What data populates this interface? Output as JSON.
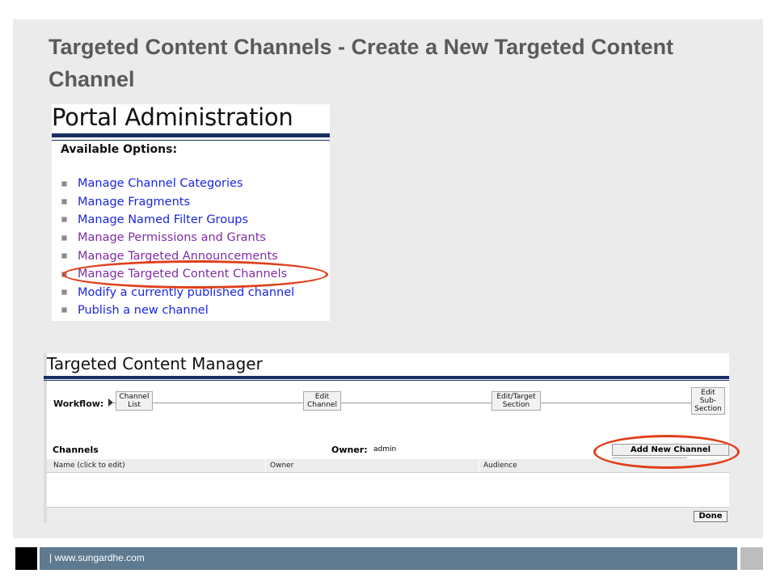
{
  "slide": {
    "title": "Targeted Content Channels - Create a New Targeted Content Channel"
  },
  "portal": {
    "title": "Portal Administration",
    "options_heading": "Available Options:",
    "options": [
      {
        "label": "Manage Channel Categories",
        "color": "#1a26e0"
      },
      {
        "label": "Manage Fragments",
        "color": "#1a26e0"
      },
      {
        "label": "Manage Named Filter Groups",
        "color": "#1a26e0"
      },
      {
        "label": "Manage Permissions and Grants",
        "color": "#7e2da6"
      },
      {
        "label": "Manage Targeted Announcements",
        "color": "#7e2da6"
      },
      {
        "label": "Manage Targeted Content Channels",
        "color": "#7e2da6"
      },
      {
        "label": "Modify a currently published channel",
        "color": "#1a26e0"
      },
      {
        "label": "Publish a new channel",
        "color": "#1a26e0"
      }
    ]
  },
  "manager": {
    "title": "Targeted Content Manager",
    "workflow_label": "Workflow:",
    "workflow_steps": [
      "Channel List",
      "Edit Channel",
      "Edit/Target Section",
      "Edit Sub-Section"
    ],
    "channels_label": "Channels",
    "owner_label": "Owner:",
    "owner_value": "admin",
    "add_button": "Add New Channel",
    "columns": [
      "Name   (click to edit)",
      "Owner",
      "Audience"
    ],
    "done_button": "Done"
  },
  "footer": {
    "text": "| www.sungardhe.com"
  },
  "colors": {
    "highlight_ellipse": "#e03f1c",
    "header_rule": "#1a2f63",
    "footer_bar": "#5e7a90"
  }
}
